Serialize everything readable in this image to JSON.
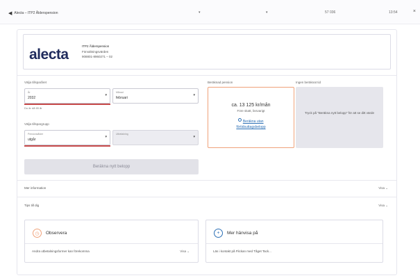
{
  "window": {
    "back_label": "Alecta – ITP2 Ålderspension",
    "col1": "▾",
    "col2": "▾",
    "col3": "57 036",
    "col4": "13:54"
  },
  "brand": {
    "logo": "alecta",
    "line1": "ITP2 Ålderspension",
    "line2": "Förvaltningsvärden",
    "line3": "908801-8960271 – 02"
  },
  "form": {
    "heading1": "Välja tillsparåret",
    "year_label": "År",
    "year_value": "2032",
    "month_label": "Månad",
    "month_value": "februari",
    "age_hint": "Du är då 65 år",
    "heading2": "Välja tillspargrupp",
    "group_label": "Pensionsålder",
    "group_value": "utgår",
    "disabled_label": "Utbetalning",
    "disabled_value": "",
    "calc_button": "Beräkna nytt belopp"
  },
  "estimate": {
    "heading": "Beräknad pension",
    "amount": "ca. 13 125 kr/mån",
    "sub": "Före skatt, livsvarigt",
    "link1": "Beräkna utan",
    "link2": "förtidsuttagsbelopp"
  },
  "info": {
    "heading": "Ingen beräknat tid",
    "text": "Tryck på \"Beräkna nytt belopp\" för att se ditt värde"
  },
  "rows": {
    "more_info": "Mer information",
    "more_info_toggle": "Visa ⌄",
    "tips": "Tips till dig",
    "tips_toggle": "Visa ⌄"
  },
  "cards": {
    "observe_title": "Observera",
    "observe_text": "Andra utbetalningsformer kan förekomma",
    "observe_more": "Visa ⌄",
    "more_title": "Mer hänvisa på",
    "more_text": "Läs i kontakt på Flickan med Tåget Tack..."
  },
  "colors": {
    "accent_orange": "#f0a27a",
    "link_blue": "#2b6fb5",
    "brand_navy": "#1f2a5c",
    "error_red": "#c84b4b"
  }
}
